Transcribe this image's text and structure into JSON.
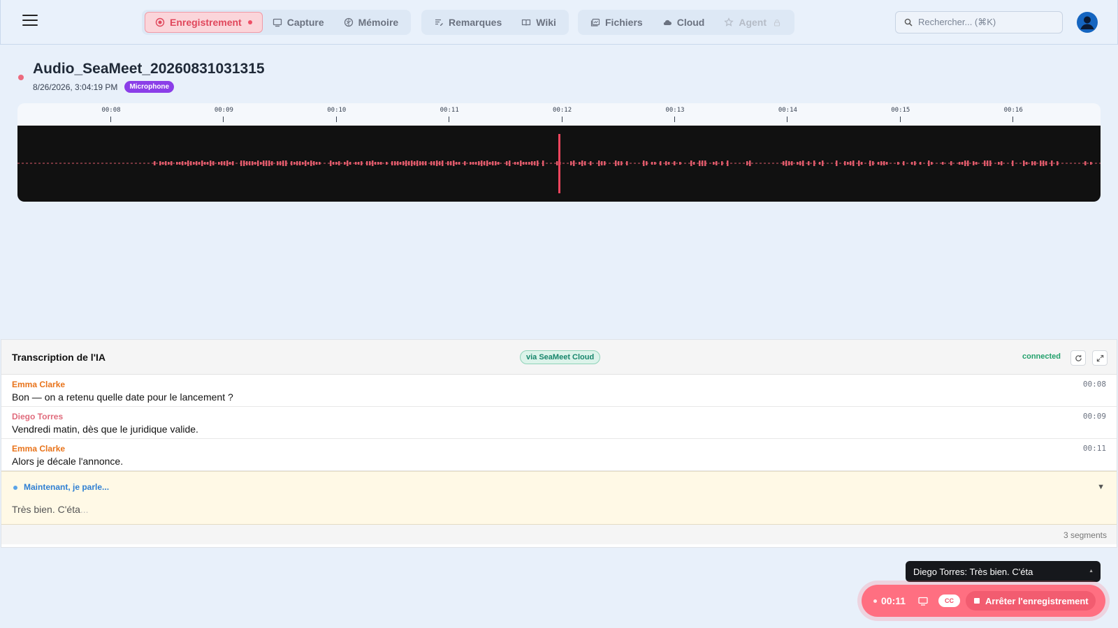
{
  "nav": {
    "tabs": [
      {
        "label": "Enregistrement",
        "icon": "record-icon",
        "active": true
      },
      {
        "label": "Capture",
        "icon": "screen-icon"
      },
      {
        "label": "Mémoire",
        "icon": "brain-icon"
      },
      {
        "label": "Remarques",
        "icon": "notes-icon"
      },
      {
        "label": "Wiki",
        "icon": "book-icon"
      },
      {
        "label": "Fichiers",
        "icon": "folder-icon"
      },
      {
        "label": "Cloud",
        "icon": "cloud-icon"
      },
      {
        "label": "Agent",
        "icon": "agent-icon",
        "disabled": true
      }
    ],
    "search_placeholder": "Rechercher... (⌘K)"
  },
  "recording": {
    "title": "Audio_SeaMeet_20260831031315",
    "datetime": "8/26/2026, 3:04:19 PM",
    "source_badge": "Microphone"
  },
  "timeline": {
    "ticks": [
      "00:08",
      "00:09",
      "00:10",
      "00:11",
      "00:12",
      "00:13",
      "00:14",
      "00:15",
      "00:16"
    ],
    "playhead": "00:12"
  },
  "transcript": {
    "title": "Transcription de l'IA",
    "via": "via SeaMeet Cloud",
    "status": "connected",
    "segments": [
      {
        "speaker": "Emma Clarke",
        "text": "Bon — on a retenu quelle date pour le lancement ?",
        "time": "00:08",
        "color": "#e8731a"
      },
      {
        "speaker": "Diego Torres",
        "text": "Vendredi matin, dès que le juridique valide.",
        "time": "00:09",
        "color": "#e06b7c"
      },
      {
        "speaker": "Emma Clarke",
        "text": "Alors je décale l'annonce.",
        "time": "00:11",
        "color": "#e8731a"
      }
    ],
    "live_label": "Maintenant, je parle...",
    "live_text": "Très bien. C'éta",
    "live_ellipsis": "...",
    "footer": "3 segments"
  },
  "caption_toast": "Diego Torres: Très bien. C'éta",
  "record_bar": {
    "timer": "00:11",
    "cc_label": "CC",
    "stop_label": "Arrêter l'enregistrement"
  },
  "colors": {
    "accent": "#ef4f66",
    "mic_badge": "#8b3ee8",
    "connected": "#22a06b"
  }
}
